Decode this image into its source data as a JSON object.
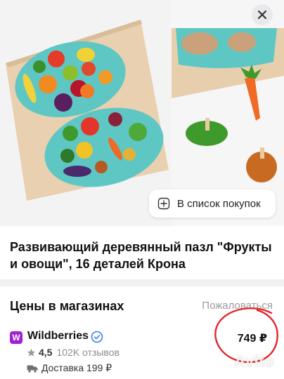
{
  "gallery": {
    "add_to_list_label": "В список покупок"
  },
  "product": {
    "title": "Развивающий деревянный пазл \"Фрукты и овощи\", 16 деталей Крона"
  },
  "prices": {
    "heading": "Цены в магазинах",
    "compare_label": "Пожаловаться",
    "offers": [
      {
        "shop_logo_letter": "W",
        "shop_name": "Wildberries",
        "price": "749 ₽",
        "rating": "4,5",
        "reviews": "102K отзывов",
        "delivery": "Доставка 199 ₽"
      }
    ]
  },
  "watermark": "Avito",
  "colors": {
    "shop_brand": "#a11ed4",
    "verified": "#3b7bf6",
    "annotation_circle": "#e3262b"
  }
}
